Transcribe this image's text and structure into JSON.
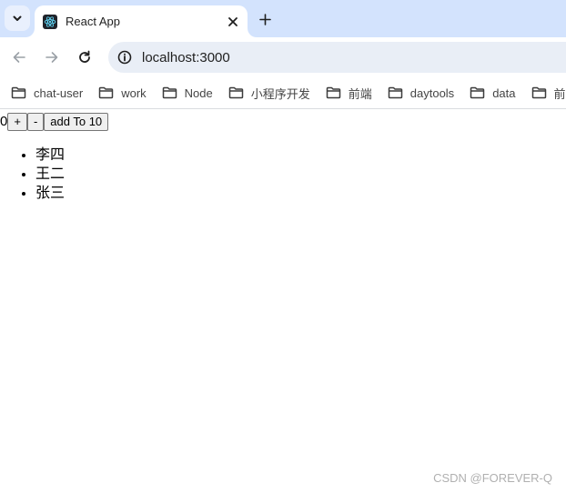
{
  "browser": {
    "tab": {
      "title": "React App",
      "favicon": "react-logo-icon",
      "close_icon": "close-icon"
    },
    "new_tab_icon": "plus-icon",
    "tab_search_icon": "chevron-down-icon",
    "nav": {
      "back_icon": "arrow-left-icon",
      "forward_icon": "arrow-right-icon",
      "reload_icon": "reload-icon"
    },
    "address": {
      "info_icon": "info-icon",
      "url": "localhost:3000"
    },
    "bookmarks": [
      {
        "label": "chat-user",
        "icon": "folder-icon"
      },
      {
        "label": "work",
        "icon": "folder-icon"
      },
      {
        "label": "Node",
        "icon": "folder-icon"
      },
      {
        "label": "小程序开发",
        "icon": "folder-icon"
      },
      {
        "label": "前端",
        "icon": "folder-icon"
      },
      {
        "label": "daytools",
        "icon": "folder-icon"
      },
      {
        "label": "data",
        "icon": "folder-icon"
      },
      {
        "label": "前端",
        "icon": "folder-icon"
      }
    ]
  },
  "page": {
    "count": "0",
    "buttons": {
      "increment": "+",
      "decrement": "-",
      "add_to_10": "add To 10"
    },
    "list": [
      "李四",
      "王二",
      "张三"
    ]
  },
  "watermark": "CSDN @FOREVER-Q"
}
